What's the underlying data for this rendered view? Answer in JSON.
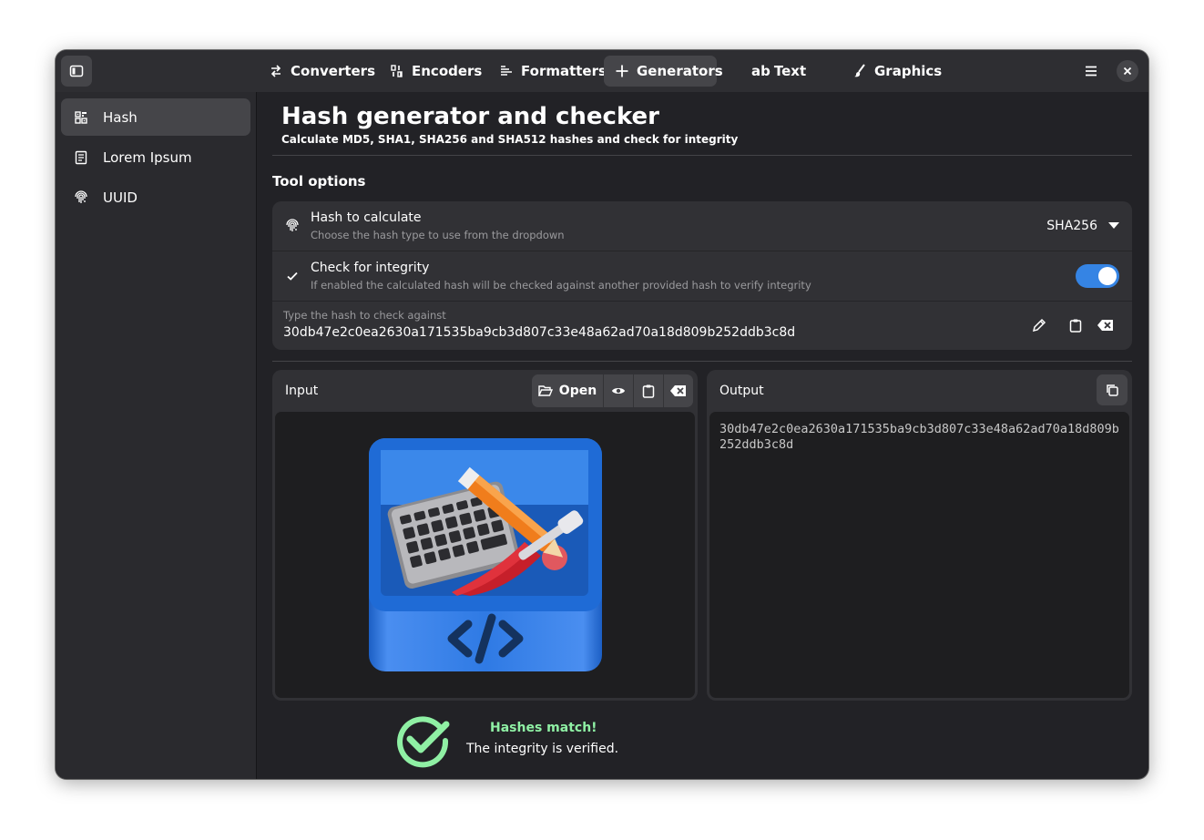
{
  "header": {
    "tabs": [
      {
        "label": "Converters",
        "icon": "swap-arrows-icon"
      },
      {
        "label": "Encoders",
        "icon": "binary-icon"
      },
      {
        "label": "Formatters",
        "icon": "text-format-icon"
      },
      {
        "label": "Generators",
        "icon": "plus-icon",
        "active": true
      },
      {
        "label": "Text",
        "icon": "text-ab-icon"
      },
      {
        "label": "Graphics",
        "icon": "brush-icon"
      }
    ]
  },
  "sidebar": {
    "items": [
      {
        "label": "Hash",
        "icon": "qr-code-icon",
        "active": true
      },
      {
        "label": "Lorem Ipsum",
        "icon": "document-icon"
      },
      {
        "label": "UUID",
        "icon": "fingerprint-icon"
      }
    ]
  },
  "page": {
    "title": "Hash generator and checker",
    "subtitle": "Calculate MD5, SHA1, SHA256 and SHA512 hashes and check for integrity"
  },
  "options": {
    "section_title": "Tool options",
    "hash_type": {
      "title": "Hash to calculate",
      "subtitle": "Choose the hash type to use from the dropdown",
      "selected": "SHA256"
    },
    "integrity": {
      "title": "Check for integrity",
      "subtitle": "If enabled the calculated hash will be checked against another provided hash to verify integrity",
      "enabled": true
    },
    "check_hash": {
      "label": "Type the hash to check against",
      "value": "30db47e2c0ea2630a171535ba9cb3d807c33e48a62ad70a18d809b252ddb3c8d"
    }
  },
  "input_panel": {
    "title": "Input",
    "open_label": "Open"
  },
  "output_panel": {
    "title": "Output",
    "value": "30db47e2c0ea2630a171535ba9cb3d807c33e48a62ad70a18d809b252ddb3c8d"
  },
  "status": {
    "title": "Hashes match!",
    "message": "The integrity is verified.",
    "color": "#8ff0a4"
  },
  "colors": {
    "accent": "#3584e4",
    "success": "#8ff0a4"
  }
}
